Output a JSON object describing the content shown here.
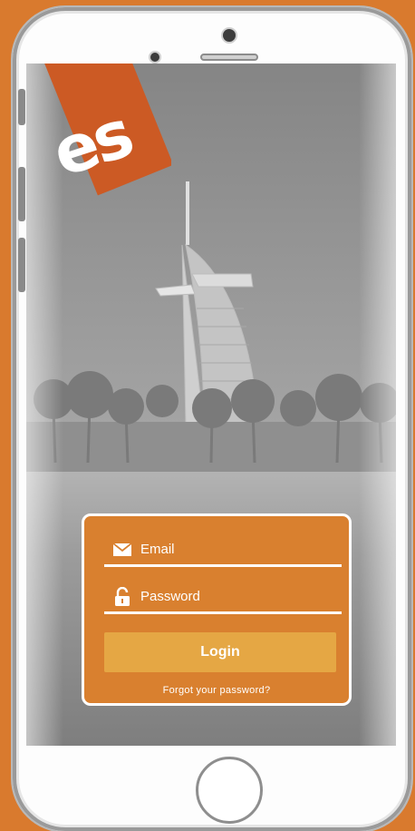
{
  "brand": {
    "logo_text": "es",
    "accent_color": "#cc5a24"
  },
  "login_form": {
    "email_placeholder": "Email",
    "password_placeholder": "Password",
    "login_label": "Login",
    "forgot_password_label": "Forgot your password?"
  },
  "colors": {
    "card_background": "#d9802f",
    "login_button": "#e5a744",
    "page_background": "#d97a2e"
  },
  "icons": [
    "envelope-icon",
    "unlocked-padlock-icon"
  ]
}
